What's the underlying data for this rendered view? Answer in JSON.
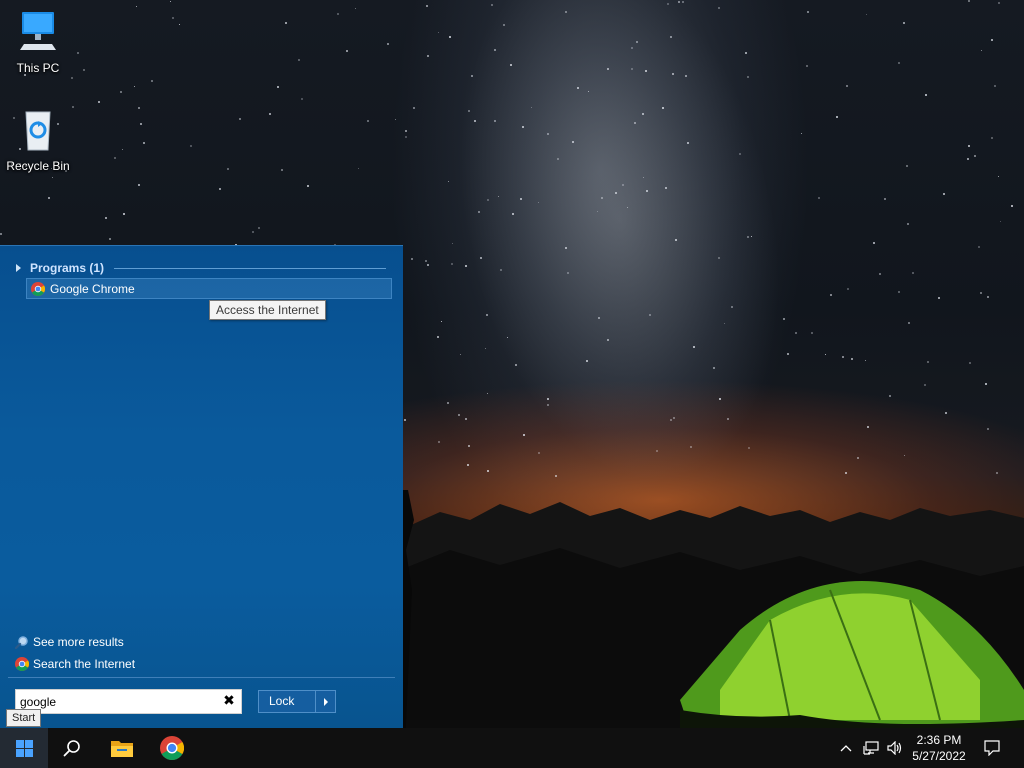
{
  "desktop": {
    "icons": [
      {
        "label": "This PC",
        "icon": "computer-icon"
      },
      {
        "label": "Recycle Bin",
        "icon": "recycle-bin-icon"
      }
    ]
  },
  "start_menu": {
    "programs_header": "Programs (1)",
    "results": [
      {
        "label": "Google Chrome",
        "icon": "chrome-icon",
        "tooltip": "Access the Internet"
      }
    ],
    "links": [
      {
        "label": "See more results",
        "icon": "search-icon"
      },
      {
        "label": "Search the Internet",
        "icon": "chrome-icon"
      }
    ],
    "search": {
      "value": "google",
      "clear_icon": "close-icon"
    },
    "power_button": {
      "label": "Lock"
    },
    "colors": {
      "panel": "#0a5a9c",
      "accent_border": "#3d84c2"
    }
  },
  "taskbar": {
    "start_tooltip": "Start",
    "pinned": [
      {
        "icon": "windows-logo-icon"
      },
      {
        "icon": "search-icon"
      },
      {
        "icon": "file-explorer-icon"
      },
      {
        "icon": "chrome-icon"
      }
    ],
    "tray_icons": [
      "chevron-up-icon",
      "network-icon",
      "volume-icon"
    ],
    "clock": {
      "time": "2:36 PM",
      "date": "5/27/2022"
    },
    "notification_icon": "action-center-icon"
  }
}
